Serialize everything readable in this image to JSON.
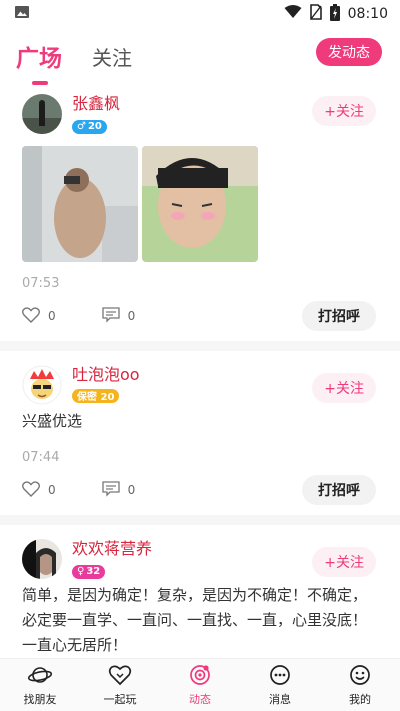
{
  "status": {
    "time": "08:10"
  },
  "header": {
    "tab_active": "广场",
    "tab_other": "关注",
    "post_button": "发动态"
  },
  "posts": [
    {
      "name": "张鑫枫",
      "badge_text": "20",
      "badge_sign": "♂",
      "follow": "+关注",
      "time": "07:53",
      "likes": "0",
      "comments": "0",
      "greet": "打招呼"
    },
    {
      "name": "吐泡泡oo",
      "badge_text": "保密 20",
      "follow": "+关注",
      "text": "兴盛优选",
      "time": "07:44",
      "likes": "0",
      "comments": "0",
      "greet": "打招呼"
    },
    {
      "name": "欢欢蒋营养",
      "badge_text": "32",
      "badge_sign": "♀",
      "follow": "+关注",
      "text": "简单，是因为确定！复杂，是因为不确定！不确定，必定要一直学、一直问、一直找、一直，心里没底！一直心无居所！"
    }
  ],
  "nav": [
    {
      "label": "找朋友"
    },
    {
      "label": "一起玩"
    },
    {
      "label": "动态"
    },
    {
      "label": "消息"
    },
    {
      "label": "我的"
    }
  ],
  "colors": {
    "accent": "#ef3a7b",
    "name": "#d7263d"
  }
}
